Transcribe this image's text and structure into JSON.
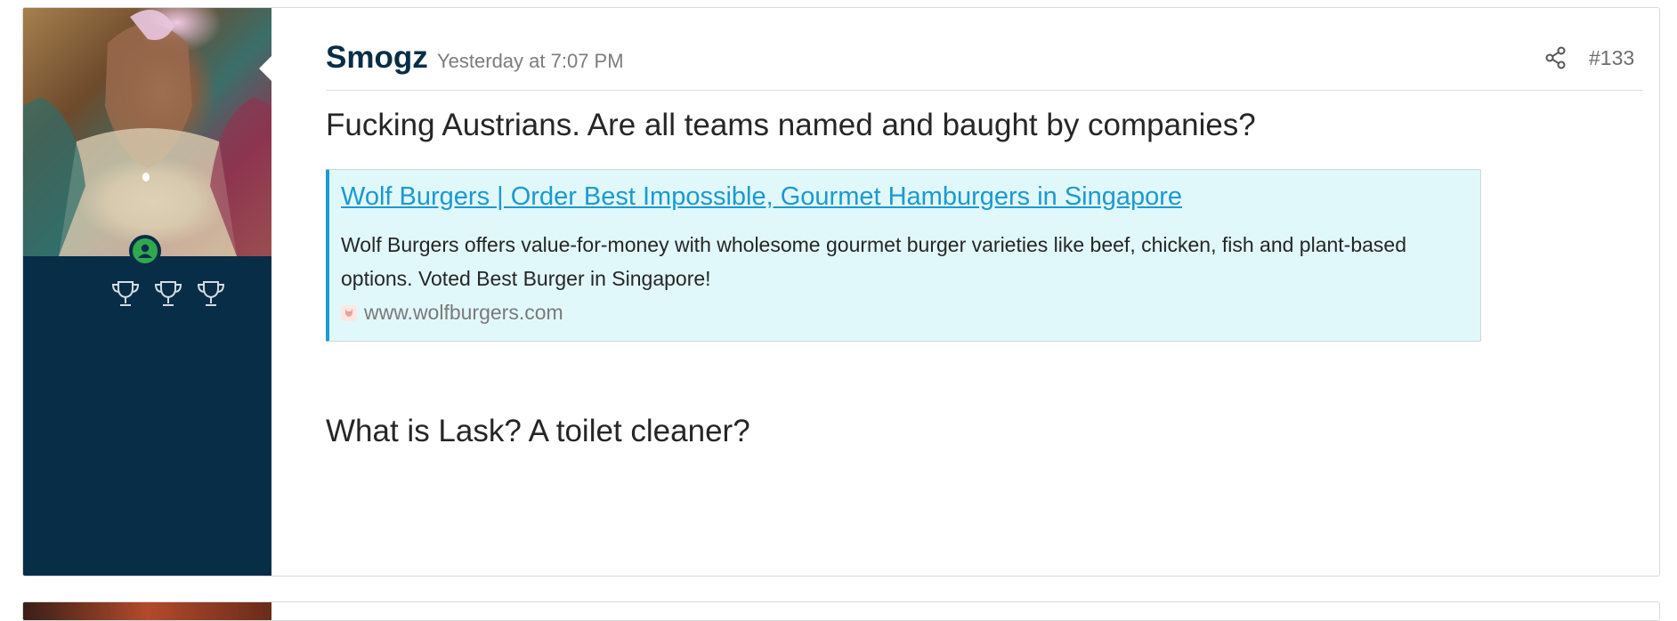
{
  "post": {
    "author": "Smogz",
    "timestamp": "Yesterday at 7:07 PM",
    "post_number": "#133",
    "paragraph_1": "Fucking Austrians. Are all teams named and baught by companies?",
    "paragraph_2": "What is Lask? A toilet cleaner?",
    "link_preview": {
      "title": "Wolf Burgers | Order Best Impossible, Gourmet Hamburgers in Singapore",
      "description": "Wolf Burgers offers value-for-money with wholesome gourmet burger varieties like beef, chicken, fish and plant-based options. Voted Best Burger in Singapore!",
      "domain": "www.wolfburgers.com"
    }
  },
  "sidebar": {
    "online_status": "online",
    "trophy_icons": [
      "trophy-icon",
      "trophy-icon",
      "trophy-icon"
    ]
  },
  "colors": {
    "sidebar_bg": "#082d47",
    "username": "#082d47",
    "link": "#1a9ad0",
    "preview_bg": "#e1f8fa",
    "preview_border": "#1e9bd4",
    "online": "#2fa84f"
  }
}
